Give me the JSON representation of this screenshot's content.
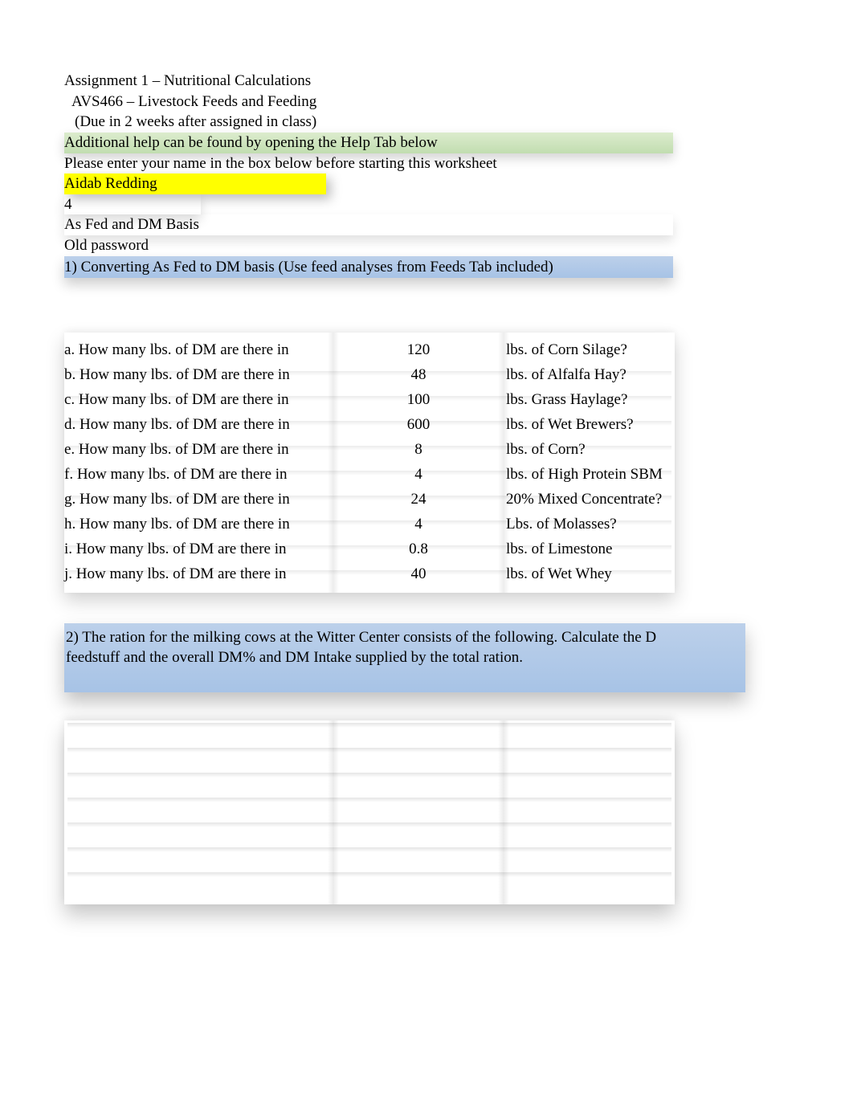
{
  "header": {
    "title": "Assignment 1 – Nutritional Calculations",
    "course": "AVS466 – Livestock Feeds and Feeding",
    "due": "(Due in 2 weeks after assigned in class)",
    "help_note": "Additional help can be found by opening the Help Tab below",
    "name_prompt": "Please enter your name in the box below before starting this worksheet",
    "student_name": "Aidab Redding",
    "mystery_number": "4",
    "basis_label": "As Fed and DM Basis",
    "old_password_label": "Old password"
  },
  "q1": {
    "prompt": "1) Converting As Fed to DM basis (Use feed analyses from Feeds Tab included)",
    "rows": [
      {
        "label": "a.  How many lbs. of DM are there in",
        "value": "120",
        "unit": "lbs. of Corn Silage?"
      },
      {
        "label": "b.  How many lbs. of DM are there in",
        "value": "48",
        "unit": "lbs. of Alfalfa Hay?"
      },
      {
        "label": "c.  How many lbs. of DM are there in",
        "value": "100",
        "unit": "lbs. Grass Haylage?"
      },
      {
        "label": "d.  How many lbs. of DM are there in",
        "value": "600",
        "unit": "lbs. of Wet Brewers?"
      },
      {
        "label": "e.  How many lbs. of DM are there in",
        "value": "8",
        "unit": "lbs. of Corn?"
      },
      {
        "label": "f.  How many lbs. of DM are there in",
        "value": "4",
        "unit": "lbs. of High Protein SBM"
      },
      {
        "label": "g.  How many lbs. of DM are there in",
        "value": "24",
        "unit": "20% Mixed Concentrate?"
      },
      {
        "label": "h.  How many lbs. of DM are there in",
        "value": "4",
        "unit": "Lbs. of Molasses?"
      },
      {
        "label": "i.  How many lbs. of DM are there in",
        "value": "0.8",
        "unit": "lbs. of Limestone"
      },
      {
        "label": "j.  How many lbs. of DM are there in",
        "value": "40",
        "unit": "lbs. of Wet Whey"
      }
    ]
  },
  "q2": {
    "prompt_line1": "2) The ration for the milking cows at the Witter Center consists of the following. Calculate the D",
    "prompt_line2": "feedstuff and the overall DM% and DM Intake supplied by the total ration.",
    "rows_count": 7
  }
}
